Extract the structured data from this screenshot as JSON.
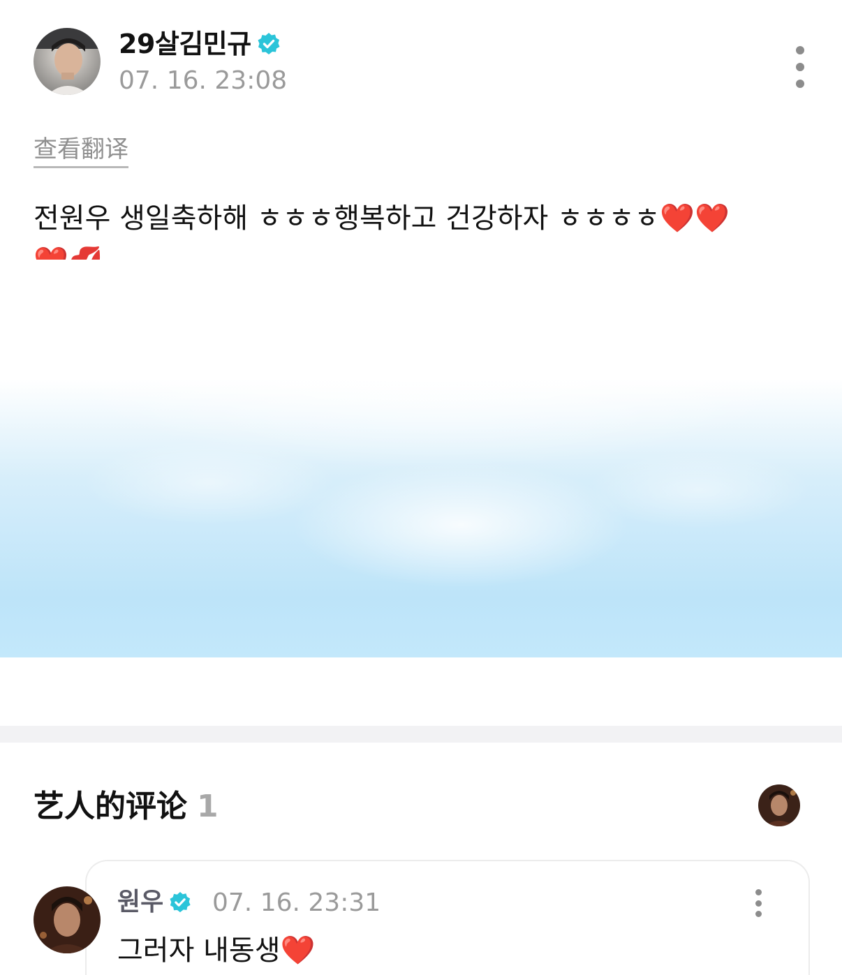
{
  "post": {
    "author_name": "29살김민규",
    "timestamp": "07. 16. 23:08",
    "translate_label": "查看翻译",
    "text": "전원우 생일축하해 ㅎㅎㅎ행복하고 건강하자 ㅎㅎㅎㅎ",
    "emojis_line1": "❤️❤️",
    "emojis_line2": "❤️💋",
    "icons": {
      "verified": "verified-badge-icon",
      "more": "more-vertical-icon"
    }
  },
  "artist_comments": {
    "title": "艺人的评论",
    "count": "1",
    "comments": [
      {
        "author": "원우",
        "timestamp": "07. 16. 23:31",
        "text": "그러자 내동생",
        "emoji": "❤️"
      }
    ]
  },
  "colors": {
    "verified_badge": "#2bc4d9",
    "sky_blue": "#bfe6fb",
    "muted_text": "#9a9a9a",
    "divider": "#f2f2f4"
  }
}
